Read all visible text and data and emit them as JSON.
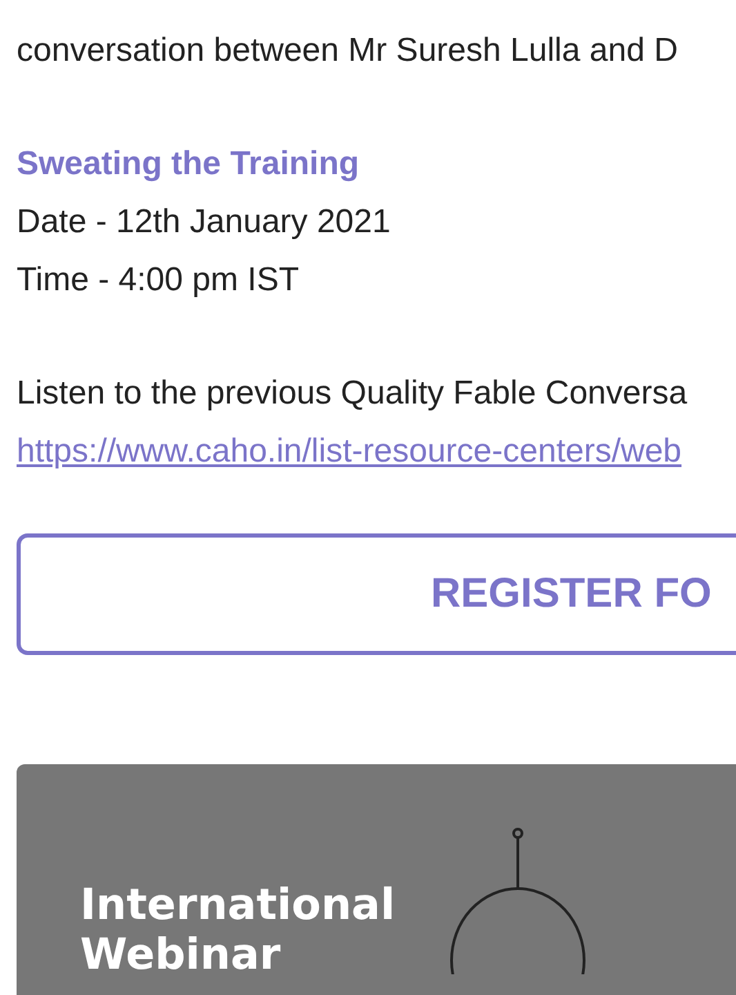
{
  "intro_lines": [
    "conversation between Mr Suresh Lulla and D"
  ],
  "session": {
    "title": "Sweating the Training",
    "date": "Date - 12th January 2021",
    "time": "Time - 4:00 pm IST"
  },
  "listen_text": "Listen to the previous Quality Fable Conversa",
  "link": "https://www.caho.in/list-resource-centers/web",
  "register_button": "REGISTER FO",
  "banner": {
    "heading": "International Webinar"
  }
}
